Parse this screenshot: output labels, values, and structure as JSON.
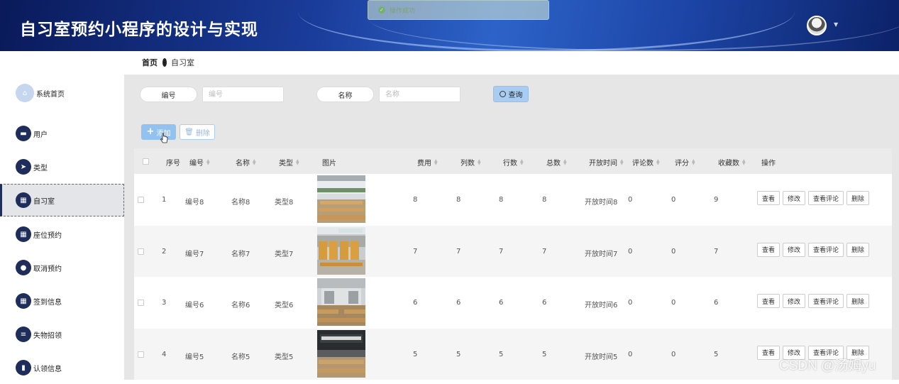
{
  "header": {
    "title": "自习室预约小程序的设计与实现",
    "toast": "操作成功"
  },
  "sidebar": {
    "items": [
      {
        "label": "系统首页",
        "icon": "home-icon"
      },
      {
        "label": "用户",
        "icon": "briefcase-icon"
      },
      {
        "label": "类型",
        "icon": "send-icon"
      },
      {
        "label": "自习室",
        "icon": "grid-icon",
        "active": true
      },
      {
        "label": "座位预约",
        "icon": "grid-icon"
      },
      {
        "label": "取消预约",
        "icon": "user-icon"
      },
      {
        "label": "签到信息",
        "icon": "grid-icon"
      },
      {
        "label": "失物招领",
        "icon": "list-icon"
      },
      {
        "label": "认领信息",
        "icon": "book-icon"
      }
    ]
  },
  "breadcrumb": {
    "home": "首页",
    "current": "自习室"
  },
  "search": {
    "fields": [
      {
        "label": "编号",
        "placeholder": "编号"
      },
      {
        "label": "名称",
        "placeholder": "名称"
      }
    ],
    "query_label": "查询"
  },
  "toolbar": {
    "add_label": "添加",
    "delete_label": "删除"
  },
  "table": {
    "headers": [
      "序号",
      "编号",
      "名称",
      "类型",
      "图片",
      "费用",
      "列数",
      "行数",
      "总数",
      "开放时间",
      "评论数",
      "评分",
      "收藏数",
      "操作"
    ],
    "rows": [
      {
        "idx": "1",
        "code": "编号8",
        "name": "名称8",
        "type": "类型8",
        "fee": "8",
        "cols": "8",
        "rows": "8",
        "total": "8",
        "open": "开放时间8",
        "comments": "0",
        "score": "0",
        "favs": "9"
      },
      {
        "idx": "2",
        "code": "编号7",
        "name": "名称7",
        "type": "类型7",
        "fee": "7",
        "cols": "7",
        "rows": "7",
        "total": "7",
        "open": "开放时间7",
        "comments": "0",
        "score": "0",
        "favs": "7"
      },
      {
        "idx": "3",
        "code": "编号6",
        "name": "名称6",
        "type": "类型6",
        "fee": "6",
        "cols": "6",
        "rows": "6",
        "total": "6",
        "open": "开放时间6",
        "comments": "0",
        "score": "0",
        "favs": "6"
      },
      {
        "idx": "4",
        "code": "编号5",
        "name": "名称5",
        "type": "类型5",
        "fee": "5",
        "cols": "5",
        "rows": "5",
        "total": "5",
        "open": "开放时间5",
        "comments": "0",
        "score": "0",
        "favs": "5"
      }
    ],
    "row_actions": [
      "查看",
      "修改",
      "查看评论",
      "删除"
    ]
  },
  "watermark": "CSDN @汤姆yu"
}
